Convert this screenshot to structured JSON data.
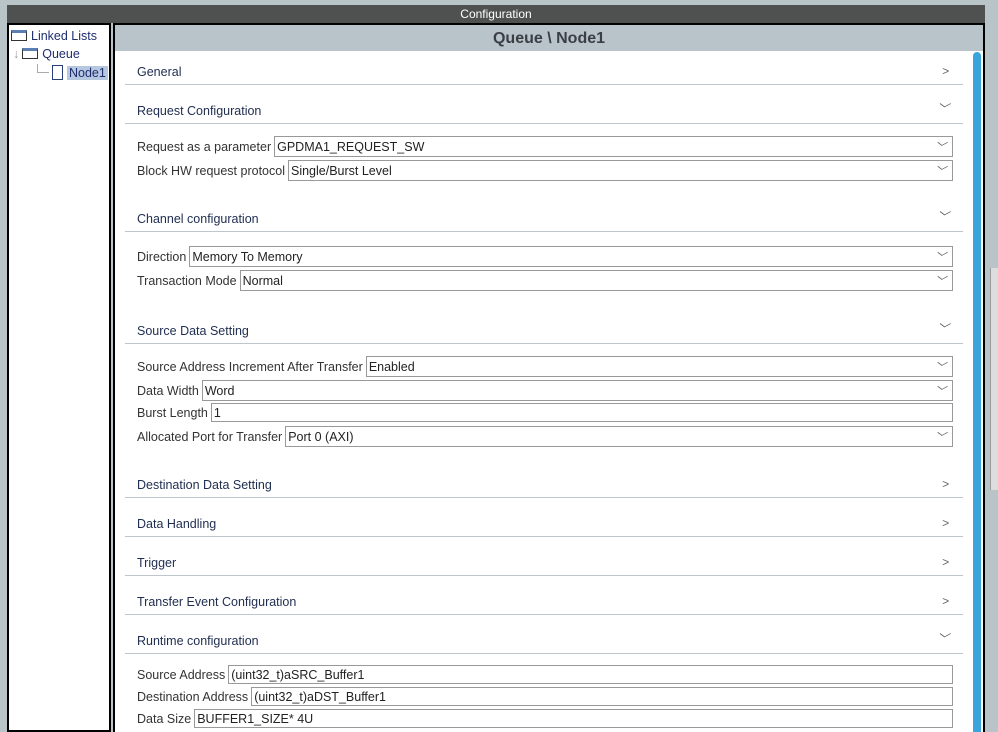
{
  "window_title": "Configuration",
  "tree": {
    "root": "Linked Lists",
    "queue": "Queue",
    "node": "Node1"
  },
  "header": "Queue \\ Node1",
  "sections": {
    "general": "General",
    "request": "Request Configuration",
    "channel": "Channel configuration",
    "source": "Source Data Setting",
    "destination": "Destination Data Setting",
    "handling": "Data Handling",
    "trigger": "Trigger",
    "transfer_event": "Transfer Event Configuration",
    "runtime": "Runtime configuration"
  },
  "fields": {
    "request_param": {
      "label": "Request as a parameter",
      "value": "GPDMA1_REQUEST_SW"
    },
    "block_hw": {
      "label": "Block HW request protocol",
      "value": "Single/Burst Level"
    },
    "direction": {
      "label": "Direction",
      "value": "Memory To Memory"
    },
    "transaction": {
      "label": "Transaction Mode",
      "value": "Normal"
    },
    "src_inc": {
      "label": "Source Address Increment After Transfer",
      "value": "Enabled"
    },
    "data_width": {
      "label": "Data Width",
      "value": "Word"
    },
    "burst": {
      "label": "Burst Length",
      "value": "1"
    },
    "port": {
      "label": "Allocated Port for Transfer",
      "value": "Port 0 (AXI)"
    },
    "src_addr": {
      "label": "Source Address",
      "value": "(uint32_t)aSRC_Buffer1"
    },
    "dst_addr": {
      "label": "Destination Address",
      "value": "(uint32_t)aDST_Buffer1"
    },
    "data_size": {
      "label": "Data Size",
      "value": "BUFFER1_SIZE* 4U"
    }
  },
  "icons": {
    "expanded": "chevron-down-icon",
    "collapsed": "chevron-right-icon"
  }
}
